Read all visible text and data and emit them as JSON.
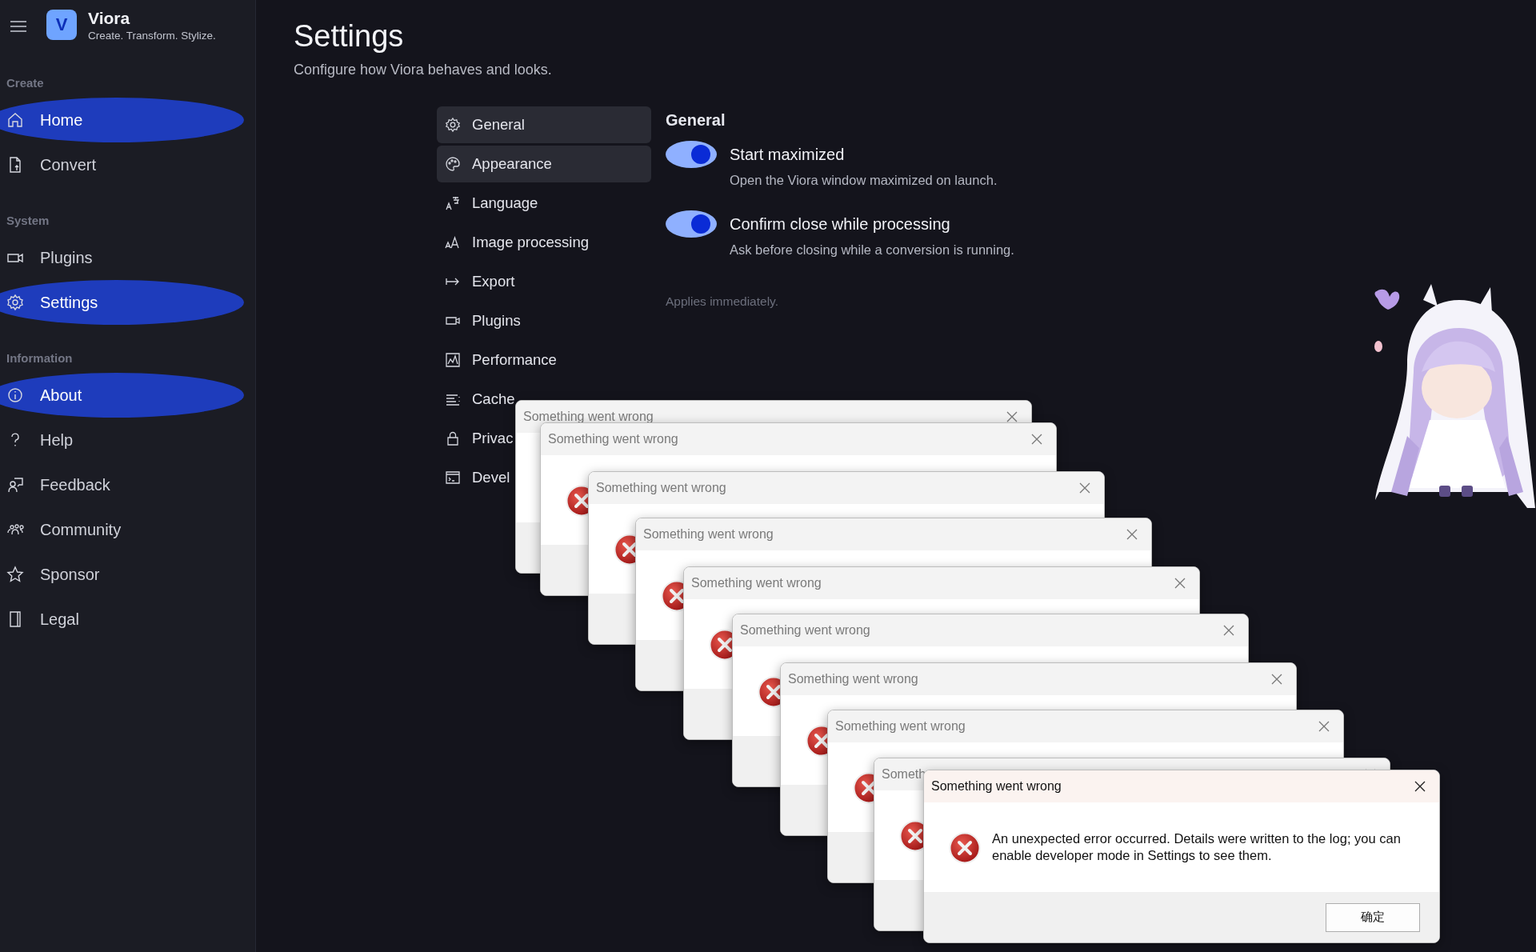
{
  "app": {
    "logo_letter": "V",
    "name": "Viora",
    "tagline": "Create. Transform. Stylize."
  },
  "sidebar": {
    "sections": [
      {
        "label": "Create",
        "items": [
          {
            "label": "Home",
            "selected": true
          },
          {
            "label": "Convert",
            "selected": false
          }
        ]
      },
      {
        "label": "System",
        "items": [
          {
            "label": "Plugins",
            "selected": false
          },
          {
            "label": "Settings",
            "selected": true
          }
        ]
      },
      {
        "label": "Information",
        "items": [
          {
            "label": "About",
            "selected": true
          },
          {
            "label": "Help",
            "selected": false
          },
          {
            "label": "Feedback",
            "selected": false
          },
          {
            "label": "Community",
            "selected": false
          },
          {
            "label": "Sponsor",
            "selected": false
          },
          {
            "label": "Legal",
            "selected": false
          }
        ]
      }
    ]
  },
  "page": {
    "title": "Settings",
    "subtitle": "Configure how Viora behaves and looks."
  },
  "settings_nav": [
    {
      "label": "General",
      "selected": true
    },
    {
      "label": "Appearance",
      "selected": true
    },
    {
      "label": "Language",
      "selected": false
    },
    {
      "label": "Image processing",
      "selected": false
    },
    {
      "label": "Export",
      "selected": false
    },
    {
      "label": "Plugins",
      "selected": false
    },
    {
      "label": "Performance",
      "selected": false
    },
    {
      "label": "Cache",
      "selected": false
    },
    {
      "label": "Privac",
      "selected": false
    },
    {
      "label": "Devel",
      "selected": false
    }
  ],
  "panel": {
    "heading": "General",
    "options": [
      {
        "title": "Start maximized",
        "description": "Open the Viora window maximized on launch.",
        "on": true
      },
      {
        "title": "Confirm close while processing",
        "description": "Ask before closing while a conversion is running.",
        "on": true
      }
    ],
    "note": "Applies immediately."
  },
  "dialogs": [
    {
      "title": "Something went wrong",
      "active": false
    },
    {
      "title": "Something went wrong",
      "active": false
    },
    {
      "title": "Something went wrong",
      "active": false
    },
    {
      "title": "Something went wrong",
      "active": false
    },
    {
      "title": "Something went wrong",
      "active": false
    },
    {
      "title": "Something went wrong",
      "active": false
    },
    {
      "title": "Something went wrong",
      "active": false
    },
    {
      "title": "Something went wrong",
      "active": false
    },
    {
      "title": "Someth",
      "active": false
    },
    {
      "title": "Something went wrong",
      "active": true,
      "message": "An unexpected error occurred. Details were written to the log; you can enable developer mode in Settings to see them.",
      "button": "确定"
    }
  ]
}
